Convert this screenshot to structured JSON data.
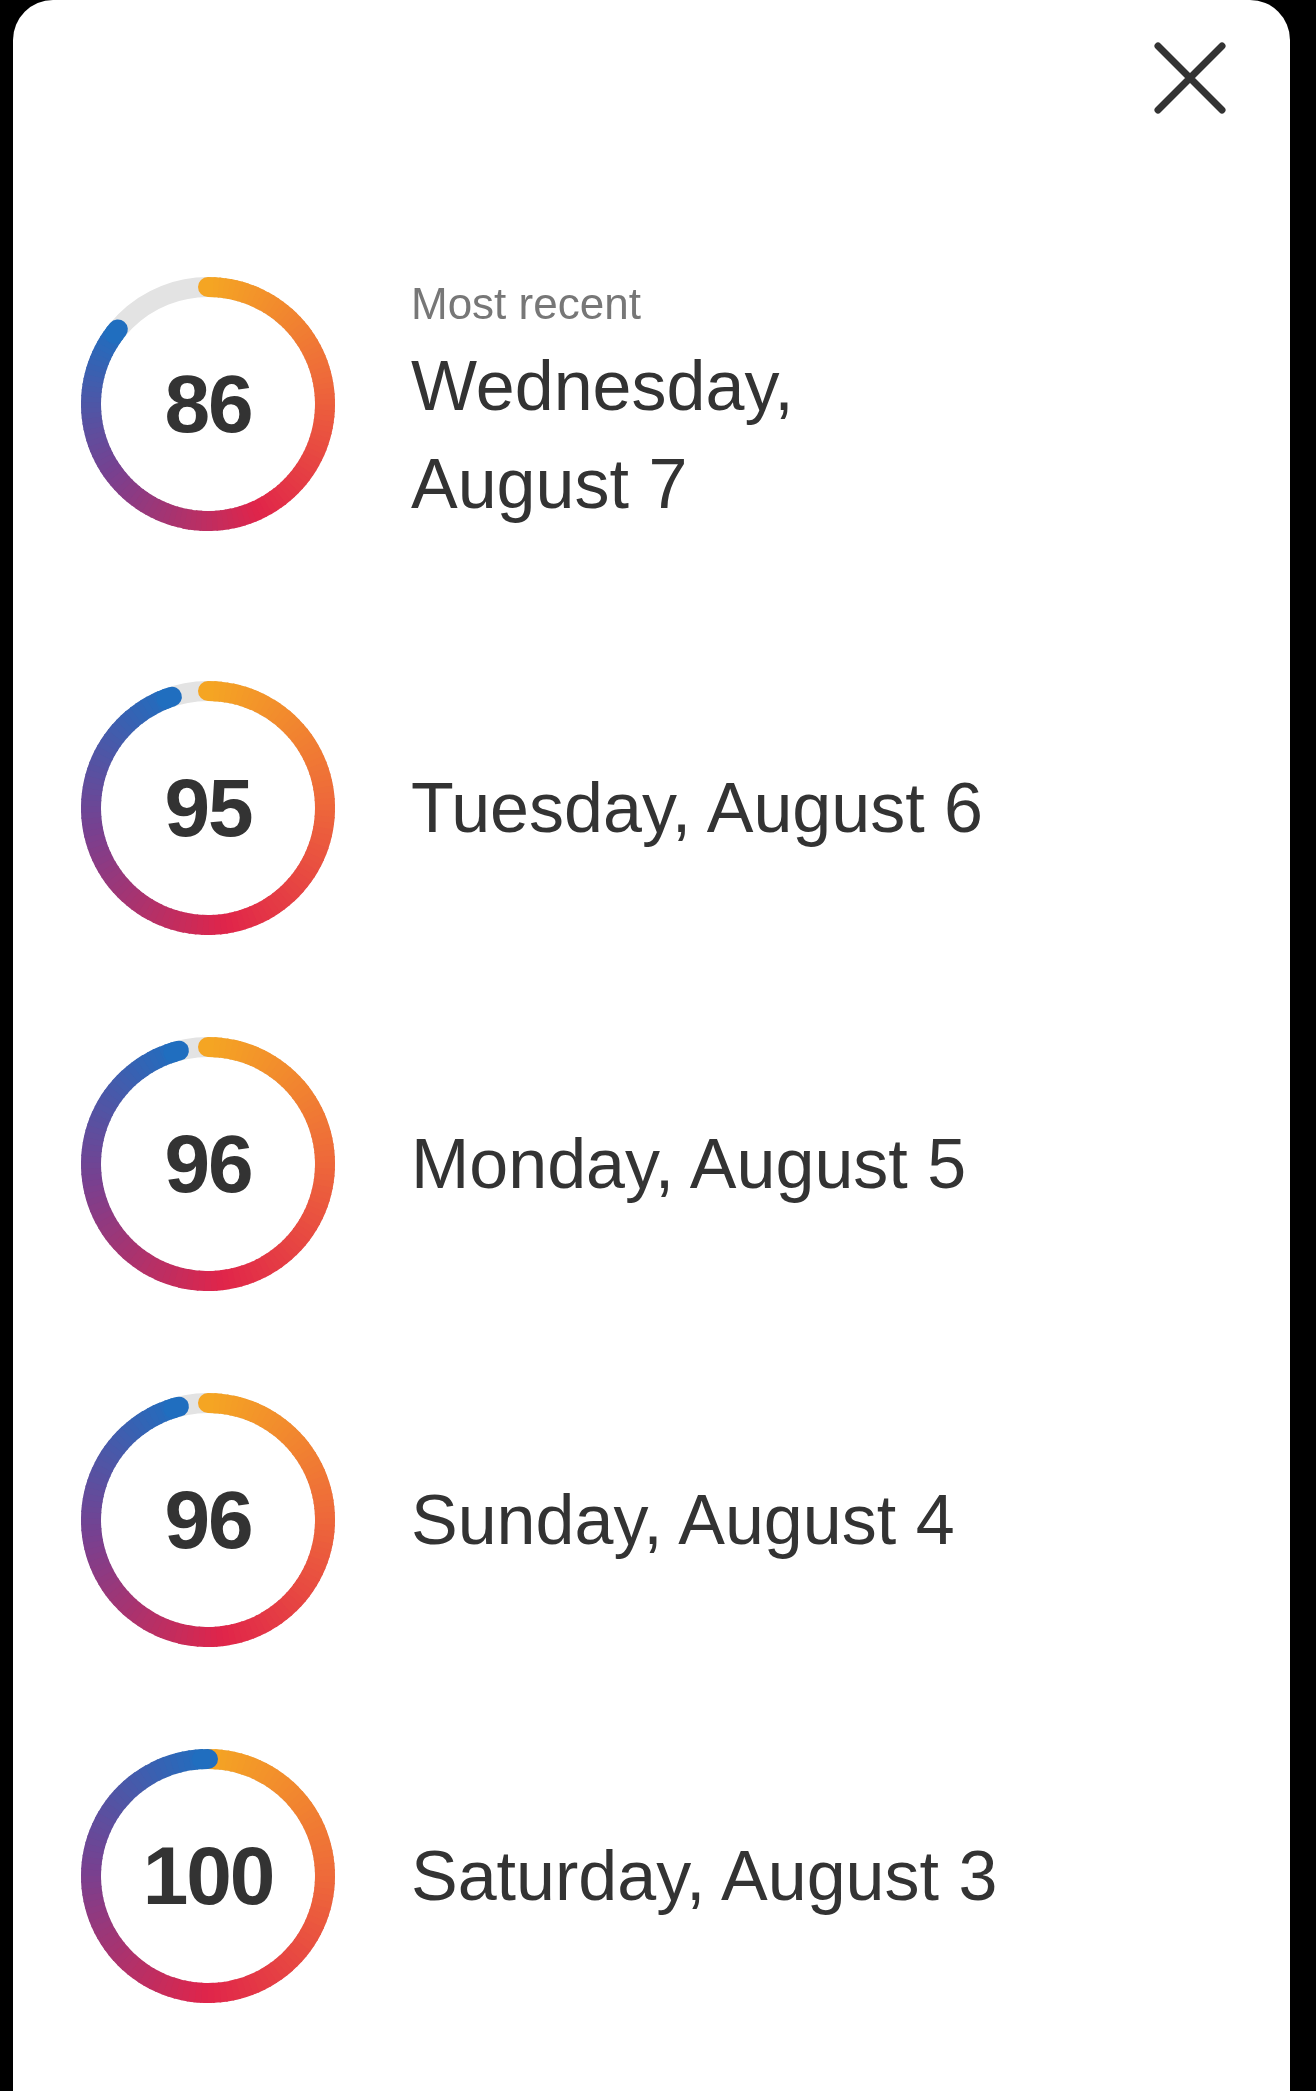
{
  "entries": [
    {
      "score": "86",
      "caption": "Most recent",
      "date": "Wednesday, August 7"
    },
    {
      "score": "95",
      "date": "Tuesday, August 6"
    },
    {
      "score": "96",
      "date": "Monday, August 5"
    },
    {
      "score": "96",
      "date": "Sunday, August 4"
    },
    {
      "score": "100",
      "date": "Saturday, August 3"
    }
  ]
}
